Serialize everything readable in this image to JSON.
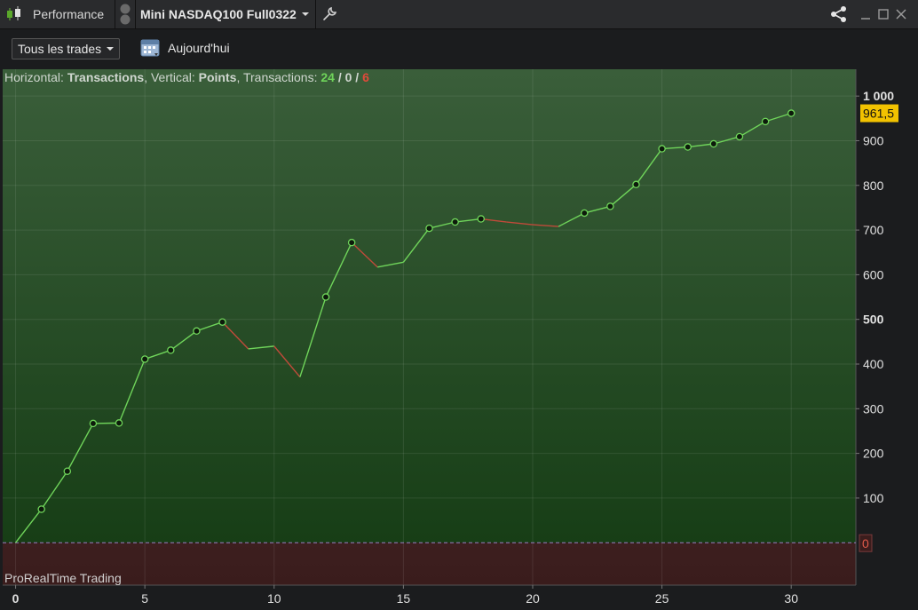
{
  "window": {
    "app_label": "Performance",
    "instrument": "Mini NASDAQ100 Full0322",
    "icons": [
      "candlestick-icon",
      "link-toggle-icon",
      "wrench-icon",
      "share-icon",
      "minimize-icon",
      "maximize-icon",
      "close-icon"
    ]
  },
  "toolbar": {
    "filter_label": "Tous les trades",
    "date_label": "Aujourd'hui"
  },
  "legend": {
    "h_prefix": "Horizontal: ",
    "h_value": "Transactions",
    "v_prefix": ", Vertical: ",
    "v_value": "Points",
    "t_prefix": ", Transactions: ",
    "wins": "24",
    "sep1": " / ",
    "neutral": "0",
    "sep2": " / ",
    "losses": "6"
  },
  "watermark": "ProRealTime Trading",
  "colors": {
    "win": "#6fd45a",
    "loss": "#c04a3a",
    "neutral": "#e8e8e8",
    "last_value_bg": "#f2c200",
    "zero_line": "#9a7fc4"
  },
  "chart_data": {
    "type": "line",
    "title": "",
    "xlabel": "",
    "ylabel": "",
    "x": [
      0,
      1,
      2,
      3,
      4,
      5,
      6,
      7,
      8,
      9,
      10,
      11,
      12,
      13,
      14,
      15,
      16,
      17,
      18,
      19,
      20,
      21,
      22,
      23,
      24,
      25,
      26,
      27,
      28,
      29,
      30
    ],
    "series": [
      {
        "values": [
          0,
          75,
          160,
          267,
          268,
          411,
          431,
          474,
          494,
          434,
          440,
          371,
          550,
          672,
          617,
          628,
          704,
          718,
          725,
          718,
          712,
          708,
          738,
          753,
          802,
          882,
          886,
          893,
          909,
          943,
          961.5
        ]
      }
    ],
    "xlim": [
      -0.5,
      32.5
    ],
    "ylim": [
      -95,
      1060
    ],
    "x_ticks": [
      0,
      5,
      10,
      15,
      20,
      25,
      30
    ],
    "x_tick_labels": [
      "0",
      "5",
      "10",
      "15",
      "20",
      "25",
      "30"
    ],
    "y_ticks": [
      100,
      200,
      300,
      400,
      500,
      600,
      700,
      800,
      900,
      1000
    ],
    "y_tick_labels": [
      "100",
      "200",
      "300",
      "400",
      "500",
      "600",
      "700",
      "800",
      "900",
      "1 000"
    ],
    "bold_y_ticks": [
      500,
      1000
    ],
    "last_value_label": "961,5",
    "zero_label": "0",
    "grid": true,
    "markers_hidden_at": [
      0,
      9,
      10,
      11,
      14,
      15,
      19,
      20,
      21
    ]
  }
}
